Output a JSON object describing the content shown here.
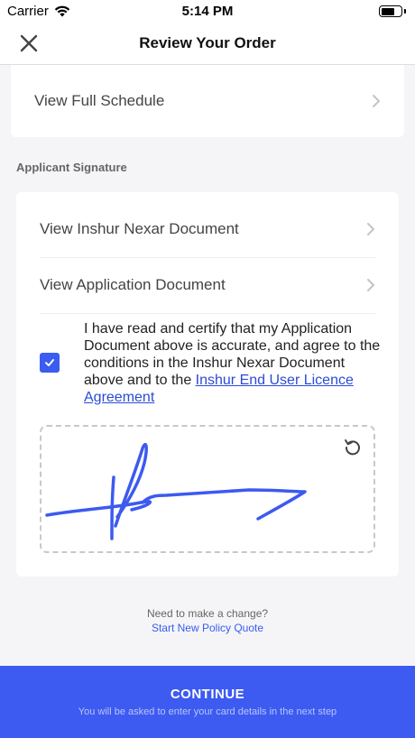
{
  "status_bar": {
    "carrier": "Carrier",
    "time": "5:14 PM"
  },
  "nav": {
    "title": "Review Your Order"
  },
  "schedule": {
    "label": "View Full Schedule"
  },
  "signature_section": {
    "title": "Applicant Signature",
    "rows": [
      {
        "label": "View Inshur Nexar Document"
      },
      {
        "label": "View Application Document"
      }
    ],
    "certify_text": "I have read and certify that my Application Document above is accurate, and agree to the conditions in the Inshur Nexar Document above and to the ",
    "certify_link": "Inshur End User Licence Agreement",
    "checked": true
  },
  "change": {
    "prompt": "Need to make a change?",
    "link": "Start New Policy Quote"
  },
  "continue": {
    "label": "CONTINUE",
    "sublabel": "You will be asked to enter your card details in the next step"
  },
  "colors": {
    "accent": "#3d5bf1",
    "link": "#2b4bd6",
    "signature": "#3c5af0"
  },
  "icons": [
    "close-icon",
    "chevron-right-icon",
    "checkmark-icon",
    "reset-icon",
    "wifi-icon",
    "battery-icon"
  ]
}
